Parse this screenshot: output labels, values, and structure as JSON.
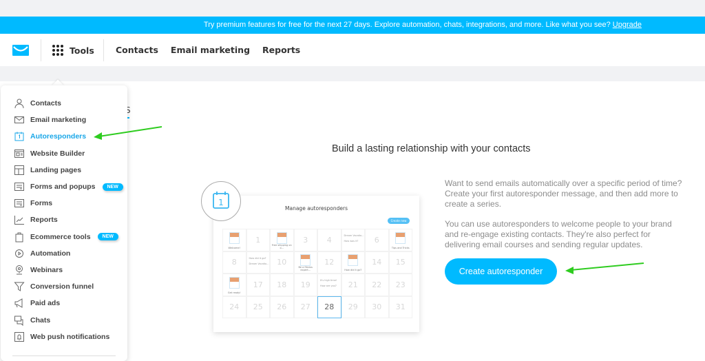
{
  "banner": {
    "text": "Try premium features for free for the next 27 days. Explore automation, chats, integrations, and more. Like what you see?",
    "link": "Upgrade"
  },
  "header": {
    "tools": "Tools",
    "nav": [
      "Contacts",
      "Email marketing",
      "Reports"
    ]
  },
  "tab_fragment": "S",
  "menu": {
    "items": [
      {
        "label": "Contacts",
        "icon": "person-icon"
      },
      {
        "label": "Email marketing",
        "icon": "envelope-icon"
      },
      {
        "label": "Autoresponders",
        "icon": "calendar-icon",
        "active": true
      },
      {
        "label": "Website Builder",
        "icon": "website-icon"
      },
      {
        "label": "Landing pages",
        "icon": "layout-icon"
      },
      {
        "label": "Forms and popups",
        "icon": "form-icon",
        "badge": "NEW"
      },
      {
        "label": "Forms",
        "icon": "form-icon"
      },
      {
        "label": "Reports",
        "icon": "chart-icon"
      },
      {
        "label": "Ecommerce tools",
        "icon": "bag-icon",
        "badge": "NEW"
      },
      {
        "label": "Automation",
        "icon": "gear-icon"
      },
      {
        "label": "Webinars",
        "icon": "webcam-icon"
      },
      {
        "label": "Conversion funnel",
        "icon": "funnel-icon"
      },
      {
        "label": "Paid ads",
        "icon": "megaphone-icon"
      },
      {
        "label": "Chats",
        "icon": "chat-icon"
      },
      {
        "label": "Web push notifications",
        "icon": "bell-icon"
      }
    ]
  },
  "main": {
    "headline": "Build a lasting relationship with your contacts",
    "para1": "Want to send emails automatically over a specific period of time? Create your first autoresponder message, and then add more to create a series.",
    "para2": "You can use autoresponders to welcome people to your brand and re-engage existing contacts. They're also perfect for delivering email courses and sending regular updates.",
    "cta": "Create autoresponder"
  },
  "illustration": {
    "icon_day": "1",
    "title": "Manage autoresponders",
    "create_btn": "Create new",
    "cells": [
      {
        "thumb": true,
        "cap": "Welcome!"
      },
      {
        "n": "1"
      },
      {
        "thumb": true,
        "cap": "Free shipping on o..."
      },
      {
        "n": "3"
      },
      {
        "n": "4"
      },
      {
        "t1": "Dream Vacatio...",
        "t2": "How was it?"
      },
      {
        "n": "6"
      },
      {
        "thumb": true,
        "cap": "Tips and Tricks"
      },
      {
        "n": "8"
      },
      {
        "t1": "How did it go?",
        "t2": "Dream Vacatio..."
      },
      {
        "n": "10"
      },
      {
        "thumb": true,
        "cap": "Be a fitness expert..."
      },
      {
        "n": "12"
      },
      {
        "thumb": true,
        "cap": "How did it go?"
      },
      {
        "n": "14"
      },
      {
        "n": "15"
      },
      {
        "thumb": true,
        "cap": "Get ready!"
      },
      {
        "n": "17"
      },
      {
        "n": "18"
      },
      {
        "n": "19"
      },
      {
        "t1": "It's high time!",
        "t2": "How are you?"
      },
      {
        "n": "21"
      },
      {
        "n": "22"
      },
      {
        "n": "23"
      },
      {
        "n": "24"
      },
      {
        "n": "25"
      },
      {
        "n": "26"
      },
      {
        "n": "27"
      },
      {
        "n": "28",
        "today": true
      },
      {
        "n": "29"
      },
      {
        "n": "30"
      },
      {
        "n": "31"
      }
    ]
  },
  "colors": {
    "brand": "#00baff",
    "active": "#1aa7e8",
    "annotation_arrow": "#2ecc1f"
  }
}
